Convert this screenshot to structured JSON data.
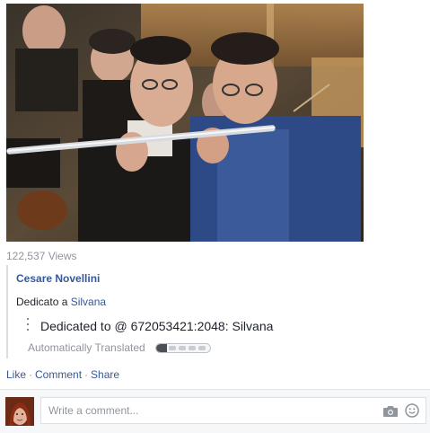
{
  "video": {
    "subject": "orchestra flute players"
  },
  "views": {
    "text": "122,537 Views"
  },
  "translation_box": {
    "author": "Cesare Novellini",
    "message_prefix": "Dedicato a ",
    "message_link": "Silvana",
    "translated_text": "Dedicated to @ 672053421:2048: Silvana",
    "auto_label": "Automatically Translated",
    "rating_level": 0.2
  },
  "actions": {
    "like": "Like",
    "comment": "Comment",
    "share": "Share",
    "separator": "·"
  },
  "comment": {
    "placeholder": "Write a comment..."
  },
  "icons": {
    "menu": "vertical-dots-icon",
    "camera": "camera-icon",
    "emoji": "smile-icon"
  },
  "colors": {
    "link": "#365899",
    "muted": "#90949c",
    "text": "#1d2129"
  }
}
